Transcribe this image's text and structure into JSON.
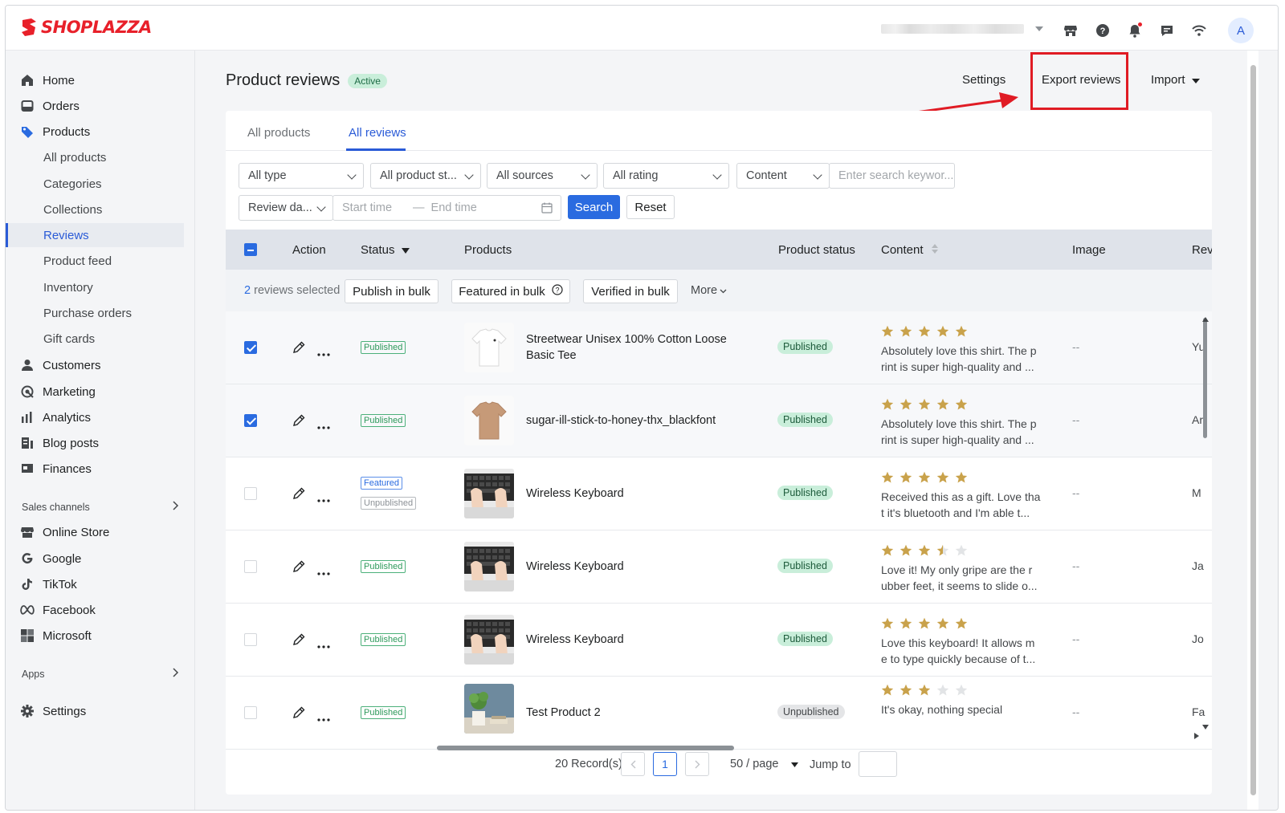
{
  "brand": {
    "name": "SHOPLAZZA",
    "color": "#e8202a"
  },
  "topbar": {
    "icons": [
      "store-icon",
      "help-icon",
      "bell-icon",
      "chat-icon",
      "wifi-icon"
    ],
    "avatar_letter": "A"
  },
  "sidebar": {
    "items": [
      {
        "label": "Home",
        "icon": "home-icon"
      },
      {
        "label": "Orders",
        "icon": "orders-icon"
      },
      {
        "label": "Products",
        "icon": "tag-icon"
      },
      {
        "label": "Customers",
        "icon": "person-icon"
      },
      {
        "label": "Marketing",
        "icon": "marketing-icon"
      },
      {
        "label": "Analytics",
        "icon": "bar-chart-icon"
      },
      {
        "label": "Blog posts",
        "icon": "blog-icon"
      },
      {
        "label": "Finances",
        "icon": "finance-icon"
      }
    ],
    "product_subitems": [
      "All products",
      "Categories",
      "Collections",
      "Reviews",
      "Product feed",
      "Inventory",
      "Purchase orders",
      "Gift cards"
    ],
    "sales_channels_label": "Sales channels",
    "channels": [
      {
        "label": "Online Store",
        "icon": "store-icon"
      },
      {
        "label": "Google",
        "icon": "google-icon"
      },
      {
        "label": "TikTok",
        "icon": "tiktok-icon"
      },
      {
        "label": "Facebook",
        "icon": "meta-icon"
      },
      {
        "label": "Microsoft",
        "icon": "microsoft-icon"
      }
    ],
    "apps_label": "Apps",
    "settings_label": "Settings"
  },
  "header": {
    "title": "Product reviews",
    "status_badge": "Active",
    "settings_label": "Settings",
    "export_label": "Export reviews",
    "import_label": "Import"
  },
  "tabs": [
    "All products",
    "All reviews"
  ],
  "filters": {
    "type": "All type",
    "product_status": "All product st...",
    "sources": "All sources",
    "rating": "All rating",
    "content": "Content",
    "search_placeholder": "Enter search keywor...",
    "date": "Review da...",
    "start_placeholder": "Start time",
    "range_sep": "—",
    "end_placeholder": "End time",
    "search_btn": "Search",
    "reset_btn": "Reset"
  },
  "table": {
    "columns": [
      "Action",
      "Status",
      "Products",
      "Product status",
      "Content",
      "Image",
      "Rev"
    ],
    "bulk": {
      "count": "2",
      "selected_text": "reviews selected",
      "publish": "Publish in bulk",
      "featured": "Featured in bulk",
      "verified": "Verified in bulk",
      "more": "More"
    },
    "rows": [
      {
        "checked": true,
        "tags": [
          "Published"
        ],
        "product": "Streetwear Unisex 100% Cotton Loose Basic Tee",
        "thumb": "white-tee",
        "product_status": "Published",
        "rating": 5,
        "content": "Absolutely love this shirt. The print is super high-quality and ...",
        "content_l1": "Absolutely love this shirt. The p",
        "content_l2": "rint is super high-quality and ...",
        "image": "--",
        "reviewer": "Yu"
      },
      {
        "checked": true,
        "tags": [
          "Published"
        ],
        "product": "sugar-ill-stick-to-honey-thx_blackfont",
        "thumb": "tan-tee",
        "product_status": "Published",
        "rating": 5,
        "content_l1": "Absolutely love this shirt. The p",
        "content_l2": "rint is super high-quality and ...",
        "image": "--",
        "reviewer": "Ar"
      },
      {
        "checked": false,
        "tags": [
          "Featured",
          "Unpublished"
        ],
        "product": "Wireless Keyboard",
        "thumb": "keyboard",
        "product_status": "Published",
        "rating": 5,
        "content_l1": "Received this as a gift. Love tha",
        "content_l2": "t it's bluetooth and I'm able t...",
        "image": "--",
        "reviewer": "M"
      },
      {
        "checked": false,
        "tags": [
          "Published"
        ],
        "product": "Wireless Keyboard",
        "thumb": "keyboard",
        "product_status": "Published",
        "rating": 3.5,
        "content_l1": "Love it! My only gripe are the r",
        "content_l2": "ubber feet, it seems to slide o...",
        "image": "--",
        "reviewer": "Ja"
      },
      {
        "checked": false,
        "tags": [
          "Published"
        ],
        "product": "Wireless Keyboard",
        "thumb": "keyboard",
        "product_status": "Published",
        "rating": 5,
        "content_l1": "Love this keyboard! It allows m",
        "content_l2": "e to type quickly because of t...",
        "image": "--",
        "reviewer": "Jo"
      },
      {
        "checked": false,
        "tags": [
          "Published"
        ],
        "product": "Test Product 2",
        "thumb": "plant",
        "product_status": "Unpublished",
        "rating": 3,
        "content_l1": "It's okay, nothing special",
        "content_l2": "",
        "image": "--",
        "reviewer": "Fa"
      }
    ]
  },
  "pagination": {
    "records": "20 Record(s)",
    "current_page": "1",
    "per_page": "50 / page",
    "jump_label": "Jump to"
  }
}
